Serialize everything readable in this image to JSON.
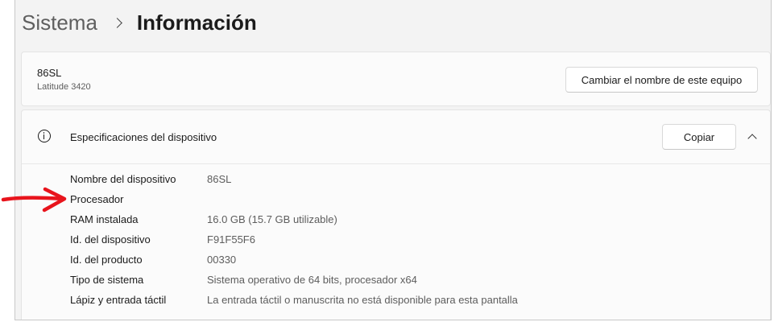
{
  "breadcrumb": {
    "parent": "Sistema",
    "current": "Información"
  },
  "device_card": {
    "name": "86SL",
    "model": "Latitude 3420",
    "rename_button": "Cambiar el nombre de este equipo"
  },
  "specs": {
    "icon": "info-icon",
    "title": "Especificaciones del dispositivo",
    "copy_button": "Copiar",
    "expanded": true,
    "rows": [
      {
        "label": "Nombre del dispositivo",
        "value": "86SL"
      },
      {
        "label": "Procesador",
        "value": ""
      },
      {
        "label": "RAM instalada",
        "value": "16.0 GB (15.7 GB utilizable)"
      },
      {
        "label": "Id. del dispositivo",
        "value": "F91F55F6"
      },
      {
        "label": "Id. del producto",
        "value": "00330"
      },
      {
        "label": "Tipo de sistema",
        "value": "Sistema operativo de 64 bits, procesador x64"
      },
      {
        "label": "Lápiz y entrada táctil",
        "value": "La entrada táctil o manuscrita no está disponible para esta pantalla"
      }
    ]
  },
  "annotation": {
    "arrow_color": "#e8141c",
    "points_to": "Procesador"
  },
  "colors": {
    "window_background": "#f3f3f3",
    "card_background": "#fbfbfb",
    "secondary_text": "#5d5d5d"
  }
}
